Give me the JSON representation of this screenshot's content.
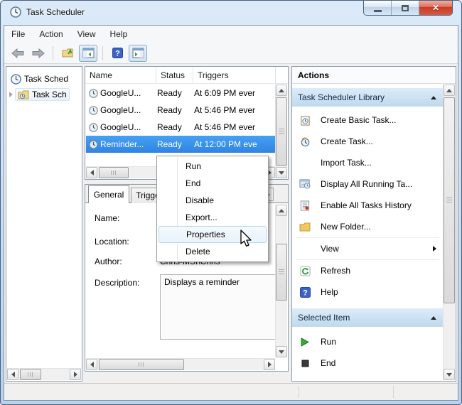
{
  "window": {
    "title": "Task Scheduler",
    "controls": {
      "minimize": "minimize",
      "maximize": "maximize",
      "close": "close"
    }
  },
  "menubar": {
    "items": [
      "File",
      "Action",
      "View",
      "Help"
    ]
  },
  "toolbar": {
    "icons": [
      "back",
      "forward",
      "export",
      "show-console-tree",
      "help",
      "show-action-pane"
    ]
  },
  "tree": {
    "items": [
      {
        "label": "Task Sched"
      },
      {
        "label": "Task Sch"
      }
    ]
  },
  "task_list": {
    "columns": [
      "Name",
      "Status",
      "Triggers"
    ],
    "rows": [
      {
        "name": "GoogleU...",
        "status": "Ready",
        "triggers": "At 6:09 PM ever",
        "selected": false
      },
      {
        "name": "GoogleU...",
        "status": "Ready",
        "triggers": "At 5:46 PM ever",
        "selected": false
      },
      {
        "name": "GoogleU...",
        "status": "Ready",
        "triggers": "At 5:46 PM ever",
        "selected": false
      },
      {
        "name": "Reminder...",
        "status": "Ready",
        "triggers": "At 12:00 PM eve",
        "selected": true
      }
    ]
  },
  "details": {
    "tabs": [
      {
        "label": "General",
        "active": true
      },
      {
        "label": "Triggers",
        "active": false
      }
    ],
    "fields": [
      {
        "label": "Name:",
        "value": ""
      },
      {
        "label": "Location:",
        "value": ""
      },
      {
        "label": "Author:",
        "value": "Chris-MSI\\Chris"
      },
      {
        "label": "Description:",
        "value": "Displays a reminder"
      }
    ]
  },
  "context_menu": {
    "items": [
      {
        "label": "Run"
      },
      {
        "label": "End"
      },
      {
        "label": "Disable"
      },
      {
        "label": "Export..."
      },
      {
        "label": "Properties",
        "highlighted": true
      },
      {
        "label": "Delete"
      }
    ]
  },
  "actions": {
    "title": "Actions",
    "sections": [
      {
        "header": "Task Scheduler Library",
        "items": [
          {
            "label": "Create Basic Task...",
            "icon": "create-basic-task-icon"
          },
          {
            "label": "Create Task...",
            "icon": "create-task-icon"
          },
          {
            "label": "Import Task...",
            "icon": ""
          },
          {
            "label": "Display All Running Ta...",
            "icon": "display-running-tasks-icon"
          },
          {
            "label": "Enable All Tasks History",
            "icon": "enable-history-icon"
          },
          {
            "label": "New Folder...",
            "icon": "new-folder-icon"
          },
          {
            "label": "View",
            "icon": "",
            "submenu": true
          },
          {
            "label": "Refresh",
            "icon": "refresh-icon"
          },
          {
            "label": "Help",
            "icon": "help-icon"
          }
        ]
      },
      {
        "header": "Selected Item",
        "items": [
          {
            "label": "Run",
            "icon": "run-icon"
          },
          {
            "label": "End",
            "icon": "end-icon"
          }
        ]
      }
    ]
  },
  "colors": {
    "selection_blue": "#3c92ec",
    "section_header_blue": "#cfe3f5",
    "close_button_red": "#cf4027",
    "aero_frame": "#bcd4eb"
  }
}
